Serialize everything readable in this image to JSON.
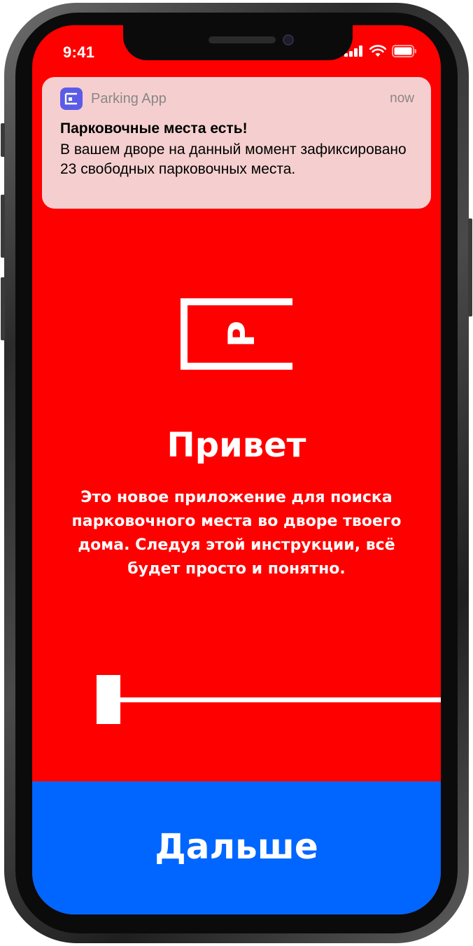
{
  "status_bar": {
    "time": "9:41"
  },
  "notification": {
    "app_name": "Parking App",
    "time": "now",
    "title": "Парковочные места есть!",
    "body": "В вашем дворе на данный момент зафиксировано 23 свободных парковочных места."
  },
  "onboarding": {
    "title": "Привет",
    "description": "Это новое приложение для поиска парковочного места во дворе твоего дома. Следуя этой инструкции, всё будет просто и понятно.",
    "logo_letter": "P",
    "step_progress": 0
  },
  "next_button": {
    "label": "Дальше"
  },
  "colors": {
    "background": "#ff0000",
    "button": "#0066ff",
    "notification_bg": "#f5cfcf",
    "app_icon": "#5b5be8",
    "text_on_color": "#ffffff"
  },
  "icons": [
    "signal-icon",
    "wifi-icon",
    "battery-icon",
    "parking-app-icon",
    "parking-logo-icon"
  ]
}
